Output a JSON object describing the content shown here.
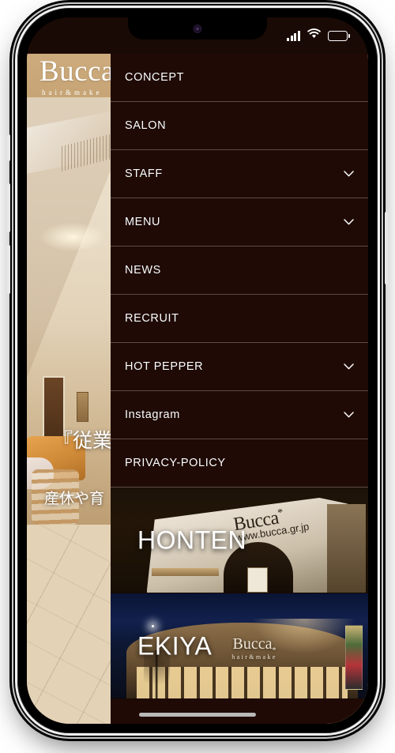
{
  "status_bar": {
    "signal_icon": "signal-bars-icon",
    "wifi_icon": "wifi-icon",
    "battery_icon": "battery-icon"
  },
  "brand": {
    "name": "Bucca",
    "tagline": "hair&make"
  },
  "hero": {
    "headline": "『従業",
    "subline": "産休や育"
  },
  "drawer": {
    "items": [
      {
        "label": "CONCEPT",
        "has_chevron": false
      },
      {
        "label": "SALON",
        "has_chevron": false
      },
      {
        "label": "STAFF",
        "has_chevron": true
      },
      {
        "label": "MENU",
        "has_chevron": true
      },
      {
        "label": "NEWS",
        "has_chevron": false
      },
      {
        "label": "RECRUIT",
        "has_chevron": false
      },
      {
        "label": "HOT PEPPER",
        "has_chevron": true
      },
      {
        "label": "Instagram",
        "has_chevron": true
      },
      {
        "label": "PRIVACY-POLICY",
        "has_chevron": false
      }
    ],
    "shops": [
      {
        "label": "HONTEN",
        "sign_name": "Bucca",
        "sign_mark": "*",
        "sign_url": "www.bucca.gr.jp"
      },
      {
        "label": "EKIYA",
        "sign_name": "Bucca",
        "sign_mark": "*",
        "sign_sub": "hair&make"
      }
    ]
  },
  "colors": {
    "drawer_bg": "#200a06",
    "divider": "#5e4b45",
    "text": "#ffffff",
    "brand_band": "#cdab7c"
  },
  "device": {
    "buttons": [
      "mute-switch",
      "volume-up-button",
      "volume-down-button",
      "power-button"
    ],
    "home_indicator": "home-indicator"
  }
}
